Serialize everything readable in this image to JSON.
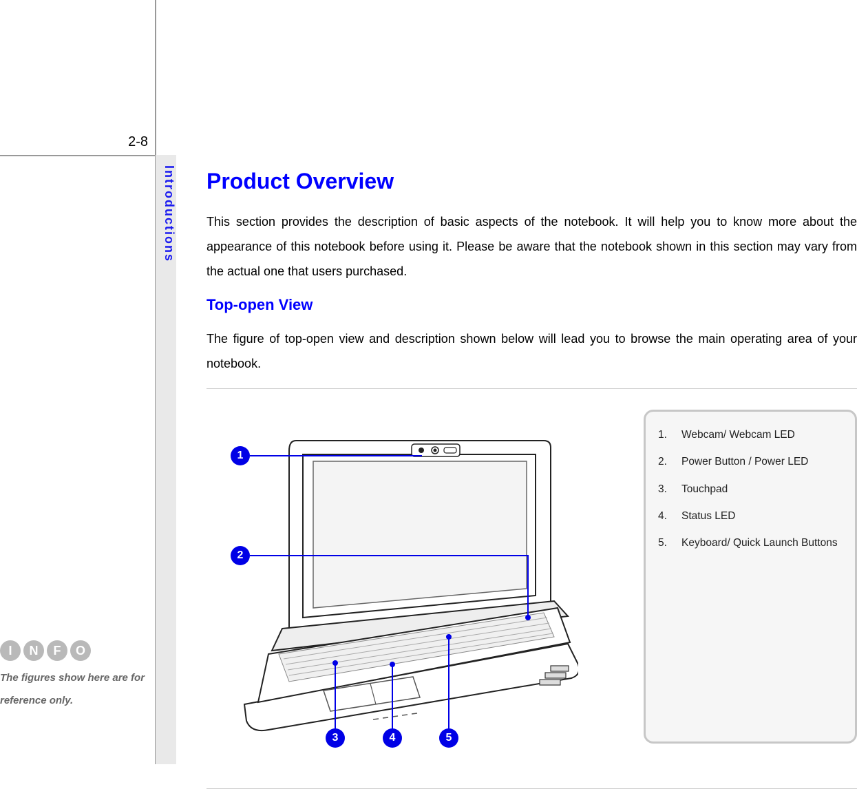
{
  "page_number": "2-8",
  "side_label": "Introductions",
  "info_letters": [
    "I",
    "N",
    "F",
    "O"
  ],
  "info_note": "The figures show here are for reference only.",
  "content": {
    "title": "Product Overview",
    "intro": "This section provides the description of basic aspects of the notebook.  It will help you to know more about the appearance of this notebook before using it. Please be aware that the notebook shown in this section may vary from the actual one that users purchased.",
    "subheading": "Top-open View",
    "sub_intro": "The figure of top-open view and description shown below will lead you to browse the main operating area of your notebook."
  },
  "callouts": [
    "1",
    "2",
    "3",
    "4",
    "5"
  ],
  "legend": [
    {
      "n": "1.",
      "t": "Webcam/ Webcam LED"
    },
    {
      "n": "2.",
      "t": "Power Button / Power LED"
    },
    {
      "n": "3.",
      "t": "Touchpad"
    },
    {
      "n": "4.",
      "t": "Status LED"
    },
    {
      "n": "5.",
      "t": "Keyboard/ Quick Launch Buttons"
    }
  ]
}
